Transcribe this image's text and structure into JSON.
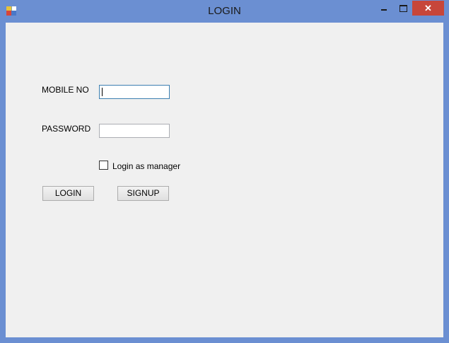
{
  "window": {
    "title": "LOGIN",
    "close_glyph": "✕"
  },
  "form": {
    "mobile_label": "MOBILE NO",
    "mobile_value": "",
    "password_label": "PASSWORD",
    "password_value": "",
    "manager_checkbox_label": "Login as manager",
    "manager_checked": false,
    "login_button": "LOGIN",
    "signup_button": "SIGNUP"
  }
}
